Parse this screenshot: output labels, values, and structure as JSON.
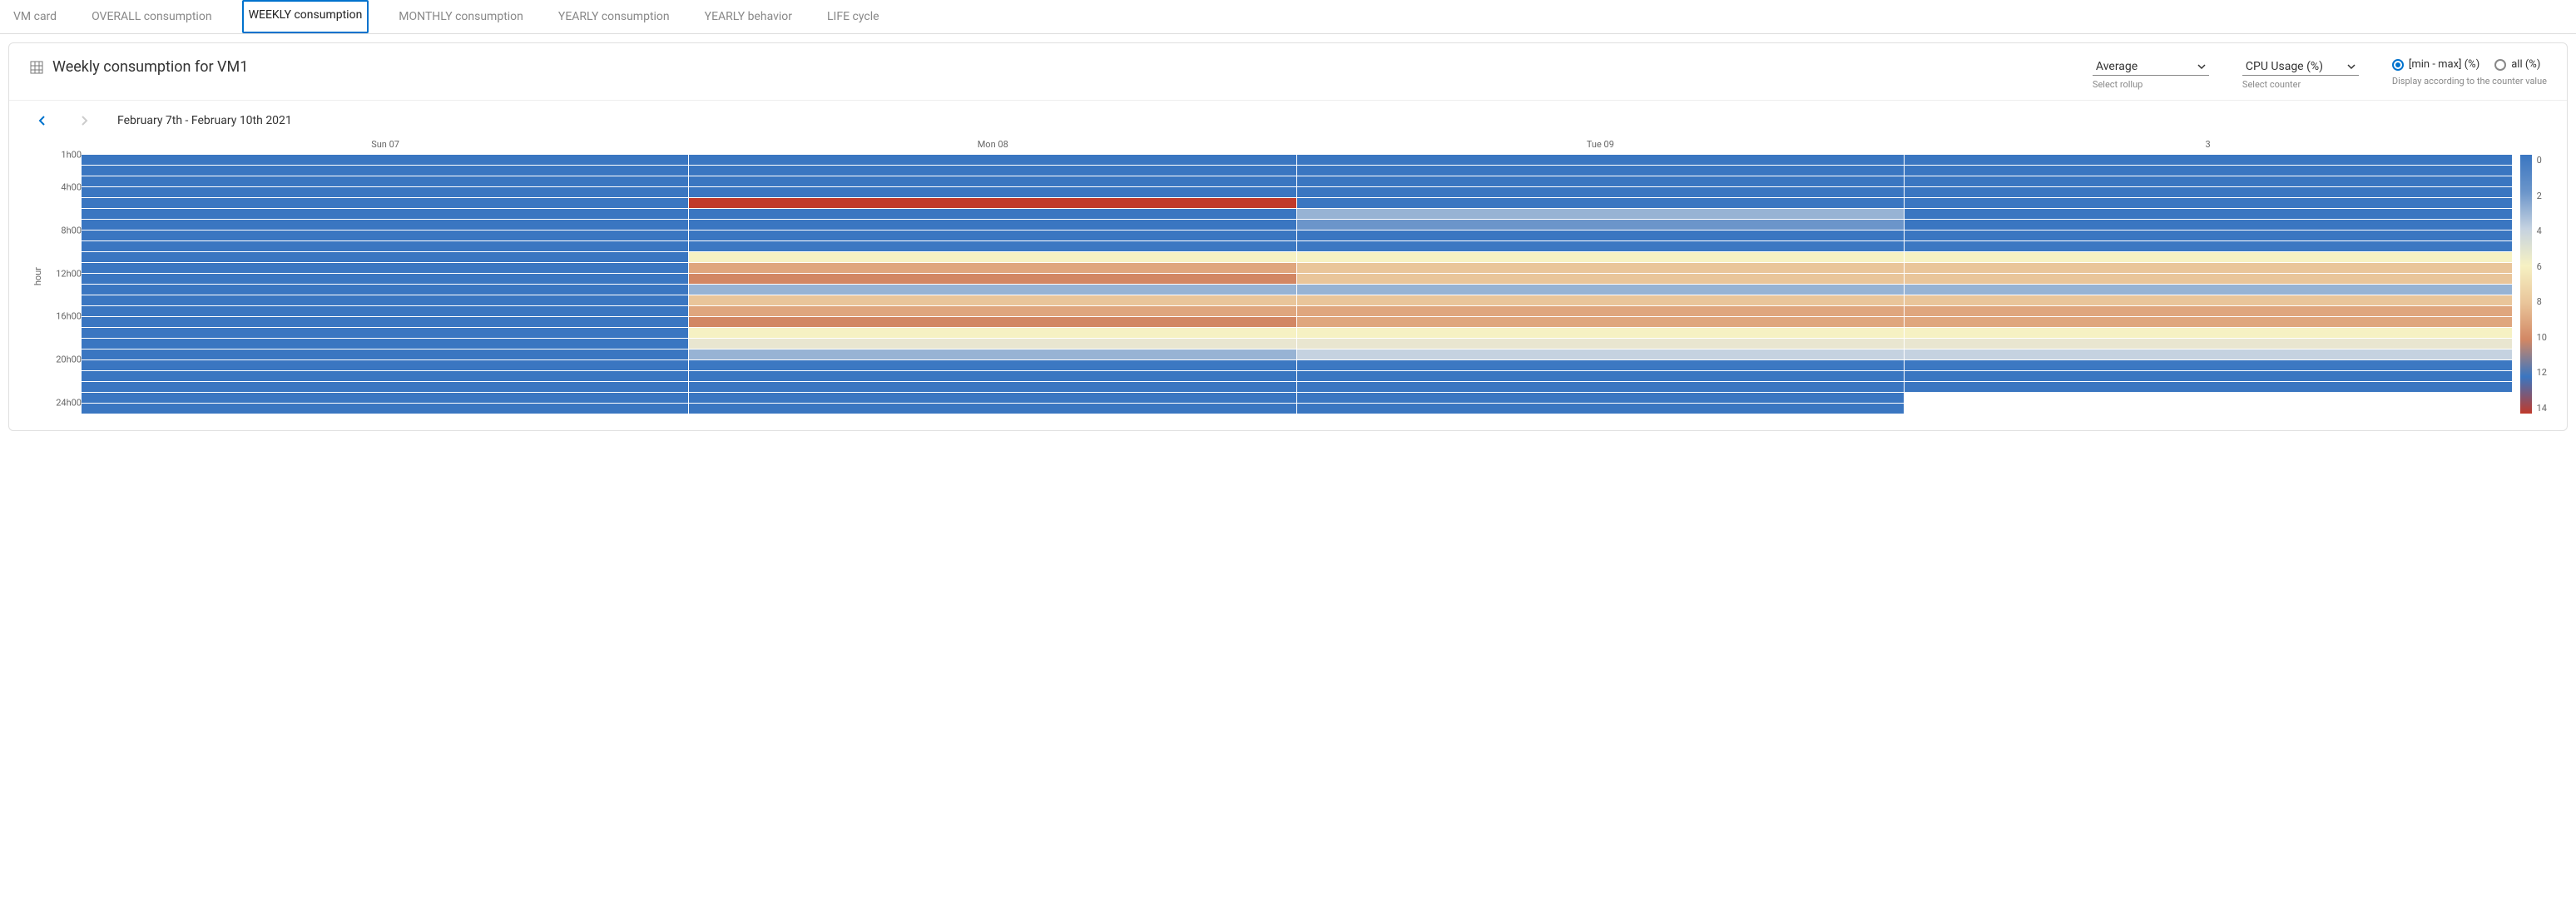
{
  "tabs": [
    {
      "label": "VM card",
      "active": false
    },
    {
      "label": "OVERALL consumption",
      "active": false
    },
    {
      "label": "WEEKLY consumption",
      "active": true
    },
    {
      "label": "MONTHLY consumption",
      "active": false
    },
    {
      "label": "YEARLY consumption",
      "active": false
    },
    {
      "label": "YEARLY behavior",
      "active": false
    },
    {
      "label": "LIFE cycle",
      "active": false
    }
  ],
  "header": {
    "title": "Weekly consumption for VM1",
    "rollup": {
      "selected": "Average",
      "label": "Select rollup"
    },
    "counter": {
      "selected": "CPU Usage (%)",
      "label": "Select counter"
    },
    "display": {
      "options": [
        {
          "label": "[min - max] (%)",
          "checked": true
        },
        {
          "label": "all (%)",
          "checked": false
        }
      ],
      "caption": "Display according to the counter value"
    }
  },
  "nav": {
    "range": "February 7th - February 10th 2021",
    "prev_enabled": true,
    "next_enabled": false
  },
  "chart_data": {
    "type": "heatmap",
    "xlabel": "",
    "ylabel": "hour",
    "x_categories": [
      "Sun 07",
      "Mon 08",
      "Tue 09",
      "3"
    ],
    "y_categories": [
      "1h00",
      "2h00",
      "3h00",
      "4h00",
      "5h00",
      "6h00",
      "7h00",
      "8h00",
      "9h00",
      "10h00",
      "11h00",
      "12h00",
      "13h00",
      "14h00",
      "15h00",
      "16h00",
      "17h00",
      "18h00",
      "19h00",
      "20h00",
      "21h00",
      "22h00",
      "23h00",
      "24h00"
    ],
    "y_ticks_shown": [
      "1h00",
      "4h00",
      "8h00",
      "12h00",
      "16h00",
      "20h00",
      "24h00"
    ],
    "colorbar": {
      "min": 0,
      "max": 14,
      "ticks": [
        0,
        2,
        4,
        6,
        8,
        10,
        12,
        14
      ]
    },
    "colors": {
      "0": "#3a76c1",
      "1": "#3c78c2",
      "2": "#6b95ca",
      "3": "#97b3d4",
      "4": "#c5d2e0",
      "5": "#e9e6d0",
      "6": "#f6f1c3",
      "7": "#f2dbaf",
      "8": "#e9c59a",
      "9": "#dfa67e",
      "10": "#d28764",
      "11": "#c76e51",
      "14": "#c03a2b",
      "null": "#ffffff"
    },
    "values": [
      [
        0,
        0,
        0,
        0
      ],
      [
        0,
        0,
        0,
        0
      ],
      [
        0,
        0,
        0,
        0
      ],
      [
        0,
        0,
        0,
        0
      ],
      [
        0,
        14,
        0,
        0
      ],
      [
        0,
        0,
        3,
        0
      ],
      [
        0,
        0,
        2,
        0
      ],
      [
        0,
        0,
        0,
        0
      ],
      [
        0,
        1,
        1,
        1
      ],
      [
        0,
        6,
        6,
        6
      ],
      [
        0,
        9,
        8,
        8
      ],
      [
        0,
        10,
        8,
        8
      ],
      [
        0,
        3,
        3,
        3
      ],
      [
        0,
        8,
        8,
        8
      ],
      [
        0,
        9,
        9,
        9
      ],
      [
        0,
        10,
        9,
        9
      ],
      [
        0,
        6,
        6,
        6
      ],
      [
        0,
        5,
        5,
        5
      ],
      [
        0,
        3,
        4,
        4
      ],
      [
        0,
        1,
        1,
        1
      ],
      [
        0,
        0,
        0,
        0
      ],
      [
        0,
        0,
        0,
        0
      ],
      [
        0,
        0,
        0,
        null
      ],
      [
        0,
        0,
        0,
        null
      ]
    ]
  }
}
